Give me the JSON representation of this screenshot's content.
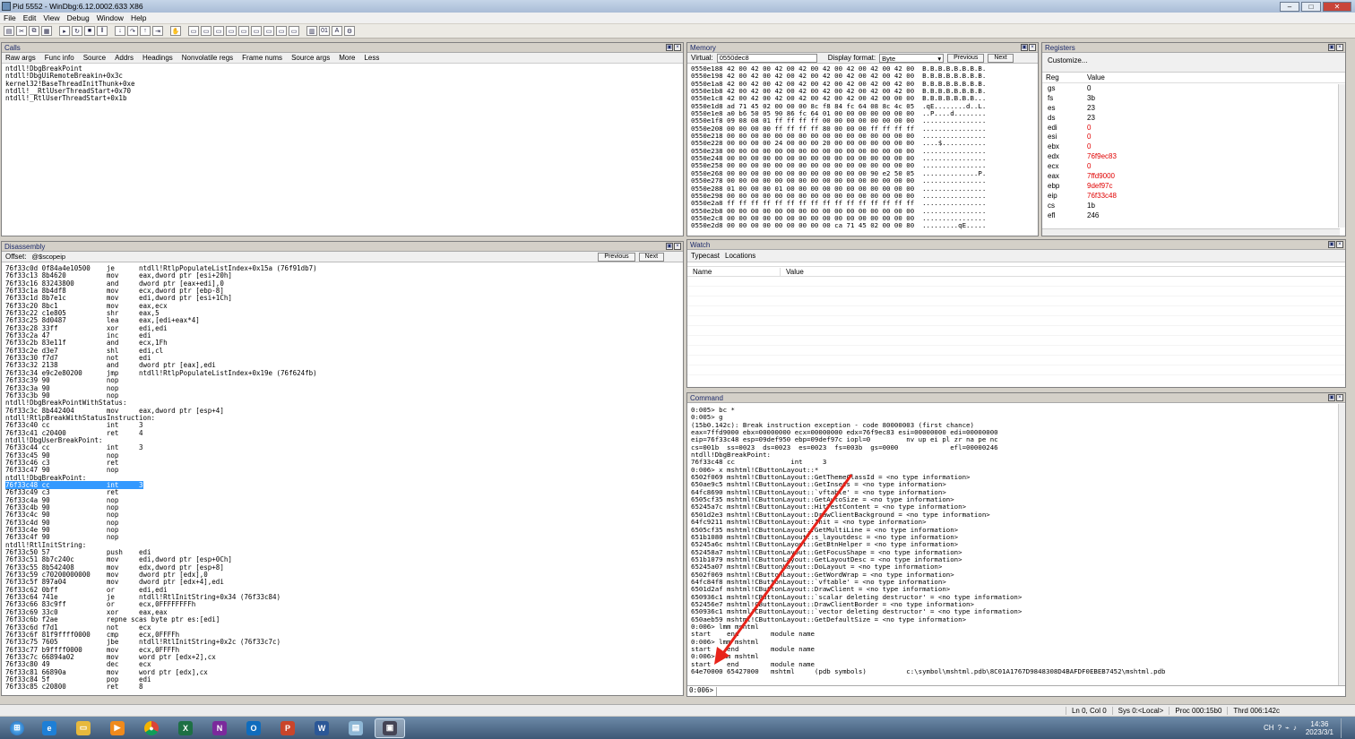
{
  "window": {
    "title": "Pid 5552 - WinDbg:6.12.0002.633 X86"
  },
  "menu": [
    "File",
    "Edit",
    "View",
    "Debug",
    "Window",
    "Help"
  ],
  "calls": {
    "title": "Calls",
    "tabs": [
      "Raw args",
      "Func info",
      "Source",
      "Addrs",
      "Headings",
      "Nonvolatile regs",
      "Frame nums",
      "Source args",
      "More",
      "Less"
    ],
    "lines": "ntdll!DbgBreakPoint\nntdll!DbgUiRemoteBreakin+0x3c\nkernel32!BaseThreadInitThunk+0xe\nntdll!__RtlUserThreadStart+0x70\nntdll!_RtlUserThreadStart+0x1b"
  },
  "memory": {
    "title": "Memory",
    "virtual_label": "Virtual:",
    "virtual_value": "0550dec8",
    "format_label": "Display format:",
    "format_value": "Byte",
    "prev": "Previous",
    "next": "Next",
    "lines": "0550e188 42 00 42 00 42 00 42 00 42 00 42 00 42 00 42 00  B.B.B.B.B.B.B.B.\n0550e198 42 00 42 00 42 00 42 00 42 00 42 00 42 00 42 00  B.B.B.B.B.B.B.B.\n0550e1a8 42 00 42 00 42 00 42 00 42 00 42 00 42 00 42 00  B.B.B.B.B.B.B.B.\n0550e1b8 42 00 42 00 42 00 42 00 42 00 42 00 42 00 42 00  B.B.B.B.B.B.B.B.\n0550e1c8 42 00 42 00 42 00 42 00 42 00 42 00 42 00 00 00  B.B.B.B.B.B.B...\n0550e1d8 ad 71 45 02 00 00 00 8c f8 84 fc 64 08 8c 4c 05  .qE........d..L.\n0550e1e8 a0 b6 50 05 90 86 fc 64 01 00 00 00 00 00 00 00  ..P....d........\n0550e1f8 09 08 08 01 ff ff ff ff 00 00 00 00 00 00 00 00  ................\n0550e208 00 00 00 00 ff ff ff ff 80 00 00 00 ff ff ff ff  ................\n0550e218 00 00 00 00 00 00 00 00 00 00 00 00 00 00 00 00  ................\n0550e228 00 00 00 00 24 00 00 00 20 00 00 00 00 00 00 00  ....$...........\n0550e238 00 00 00 00 00 00 00 00 00 00 00 00 00 00 00 00  ................\n0550e248 00 00 00 00 00 00 00 00 00 00 00 00 00 00 00 00  ................\n0550e258 00 00 00 00 00 00 00 00 00 00 00 00 00 00 00 00  ................\n0550e268 00 00 00 00 00 00 00 00 00 00 00 00 90 e2 50 05  ..............P.\n0550e278 00 00 00 00 00 00 00 00 00 00 00 00 00 00 00 00  ................\n0550e288 01 00 00 00 01 00 00 00 00 00 00 00 00 00 00 00  ................\n0550e298 00 00 00 00 00 00 00 00 00 00 00 00 00 00 00 00  ................\n0550e2a8 ff ff ff ff ff ff ff ff ff ff ff ff ff ff ff ff  ................\n0550e2b8 00 00 00 00 00 00 00 00 00 00 00 00 00 00 00 00  ................\n0550e2c8 00 00 00 00 00 00 00 00 00 00 00 00 00 00 00 00  ................\n0550e2d8 00 00 00 00 00 00 00 00 00 ca 71 45 02 00 00 80  .........qE....."
  },
  "registers": {
    "title": "Registers",
    "customize": "Customize...",
    "col_reg": "Reg",
    "col_value": "Value",
    "items": [
      {
        "n": "gs",
        "v": "0"
      },
      {
        "n": "fs",
        "v": "3b"
      },
      {
        "n": "es",
        "v": "23"
      },
      {
        "n": "ds",
        "v": "23"
      },
      {
        "n": "edi",
        "v": "0"
      },
      {
        "n": "esi",
        "v": "0"
      },
      {
        "n": "ebx",
        "v": "0"
      },
      {
        "n": "edx",
        "v": "76f9ec83"
      },
      {
        "n": "ecx",
        "v": "0"
      },
      {
        "n": "eax",
        "v": "7ffd9000"
      },
      {
        "n": "ebp",
        "v": "9def97c"
      },
      {
        "n": "eip",
        "v": "76f33c48"
      },
      {
        "n": "cs",
        "v": "1b"
      },
      {
        "n": "efl",
        "v": "246"
      }
    ],
    "changed_color": "#e00000"
  },
  "disassembly": {
    "title": "Disassembly",
    "offset_label": "Offset:",
    "offset_value": "@$scopeip",
    "prev": "Previous",
    "next": "Next",
    "before": "76f33c0d 0f84a4e10500    je      ntdll!RtlpPopulateListIndex+0x15a (76f91db7)\n76f33c13 8b4620          mov     eax,dword ptr [esi+20h]\n76f33c16 83243800        and     dword ptr [eax+edi],0\n76f33c1a 8b4df8          mov     ecx,dword ptr [ebp-8]\n76f33c1d 8b7e1c          mov     edi,dword ptr [esi+1Ch]\n76f33c20 8bc1            mov     eax,ecx\n76f33c22 c1e805          shr     eax,5\n76f33c25 8d0487          lea     eax,[edi+eax*4]\n76f33c28 33ff            xor     edi,edi\n76f33c2a 47              inc     edi\n76f33c2b 83e11f          and     ecx,1Fh\n76f33c2e d3e7            shl     edi,cl\n76f33c30 f7d7            not     edi\n76f33c32 2138            and     dword ptr [eax],edi\n76f33c34 e9c2e80200      jmp     ntdll!RtlpPopulateListIndex+0x19e (76f624fb)\n76f33c39 90              nop\n76f33c3a 90              nop\n76f33c3b 90              nop\nntdll!DbgBreakPointWithStatus:\n76f33c3c 8b442404        mov     eax,dword ptr [esp+4]\nntdll!RtlpBreakWithStatusInstruction:\n76f33c40 cc              int     3\n76f33c41 c20400          ret     4\nntdll!DbgUserBreakPoint:\n76f33c44 cc              int     3\n76f33c45 90              nop\n76f33c46 c3              ret\n76f33c47 90              nop\nntdll!DbgBreakPoint:",
    "current": "76f33c48 cc              int     3",
    "after": "76f33c49 c3              ret\n76f33c4a 90              nop\n76f33c4b 90              nop\n76f33c4c 90              nop\n76f33c4d 90              nop\n76f33c4e 90              nop\n76f33c4f 90              nop\nntdll!RtlInitString:\n76f33c50 57              push    edi\n76f33c51 8b7c240c        mov     edi,dword ptr [esp+0Ch]\n76f33c55 8b542408        mov     edx,dword ptr [esp+8]\n76f33c59 c70200000000    mov     dword ptr [edx],0\n76f33c5f 897a04          mov     dword ptr [edx+4],edi\n76f33c62 0bff            or      edi,edi\n76f33c64 741e            je      ntdll!RtlInitString+0x34 (76f33c84)\n76f33c66 83c9ff          or      ecx,0FFFFFFFFh\n76f33c69 33c0            xor     eax,eax\n76f33c6b f2ae            repne scas byte ptr es:[edi]\n76f33c6d f7d1            not     ecx\n76f33c6f 81f9ffff0000    cmp     ecx,0FFFFh\n76f33c75 7605            jbe     ntdll!RtlInitString+0x2c (76f33c7c)\n76f33c77 b9ffff0000      mov     ecx,0FFFFh\n76f33c7c 66894a02        mov     word ptr [edx+2],cx\n76f33c80 49              dec     ecx\n76f33c81 66890a          mov     word ptr [edx],cx\n76f33c84 5f              pop     edi\n76f33c85 c20800          ret     8"
  },
  "watch": {
    "title": "Watch",
    "tabs": [
      "Typecast",
      "Locations"
    ],
    "col_name": "Name",
    "col_value": "Value"
  },
  "command": {
    "title": "Command",
    "prompt": "0:006>",
    "output": "0:005> bc *\n0:005> g\n(15b0.142c): Break instruction exception - code 80000003 (first chance)\neax=7ffd9000 ebx=00000000 ecx=00000000 edx=76f9ec83 esi=00000000 edi=00000000\neip=76f33c48 esp=09def950 ebp=09def97c iopl=0         nv up ei pl zr na pe nc\ncs=001b  ss=0023  ds=0023  es=0023  fs=003b  gs=0000             efl=00000246\nntdll!DbgBreakPoint:\n76f33c48 cc              int     3\n0:006> x mshtml!CButtonLayout::*\n6502f069 mshtml!CButtonLayout::GetThemeClassId = <no type information>\n650ae9c5 mshtml!CButtonLayout::GetInsets = <no type information>\n64fc8690 mshtml!CButtonLayout::`vftable' = <no type information>\n6505cf35 mshtml!CButtonLayout::GetAutoSize = <no type information>\n65245a7c mshtml!CButtonLayout::HitTestContent = <no type information>\n6501d2e3 mshtml!CButtonLayout::DrawClientBackground = <no type information>\n64fc9211 mshtml!CButtonLayout::Init = <no type information>\n6505cf35 mshtml!CButtonLayout::GetMultiLine = <no type information>\n651b1080 mshtml!CButtonLayout::s_layoutdesc = <no type information>\n65245a6c mshtml!CButtonLayout::GetBtnHelper = <no type information>\n652458a7 mshtml!CButtonLayout::GetFocusShape = <no type information>\n651b1079 mshtml!CButtonLayout::GetLayoutDesc = <no type information>\n65245a07 mshtml!CButtonLayout::DoLayout = <no type information>\n6502f069 mshtml!CButtonLayout::GetWordWrap = <no type information>\n64fc84f8 mshtml!CButtonLayout::`vftable' = <no type information>\n6501d2af mshtml!CButtonLayout::DrawClient = <no type information>\n650936c1 mshtml!CButtonLayout::`scalar deleting destructor' = <no type information>\n652456e7 mshtml!CButtonLayout::DrawClientBorder = <no type information>\n650936c1 mshtml!CButtonLayout::`vector deleting destructor' = <no type information>\n650aeb59 mshtml!CButtonLayout::GetDefaultSize = <no type information>\n0:006> lmm mshtml\nstart    end        module name\n0:006> lmm mshtml\nstart    end        module name\n0:006> lmm mshtml\nstart    end        module name\n64e70000 65427000   mshtml     (pdb symbols)          c:\\symbol\\mshtml.pdb\\8C01A1767D9848308D4BAFDF0EBEB7452\\mshtml.pdb"
  },
  "status": [
    "Ln 0, Col 0",
    "Sys 0:<Local>",
    "Proc 000:15b0",
    "Thrd 006:142c"
  ],
  "taskbar": {
    "time": "14:36",
    "date": "2023/3/1"
  },
  "accent_color": "#3399ff",
  "arrow_color": "#e8231a"
}
